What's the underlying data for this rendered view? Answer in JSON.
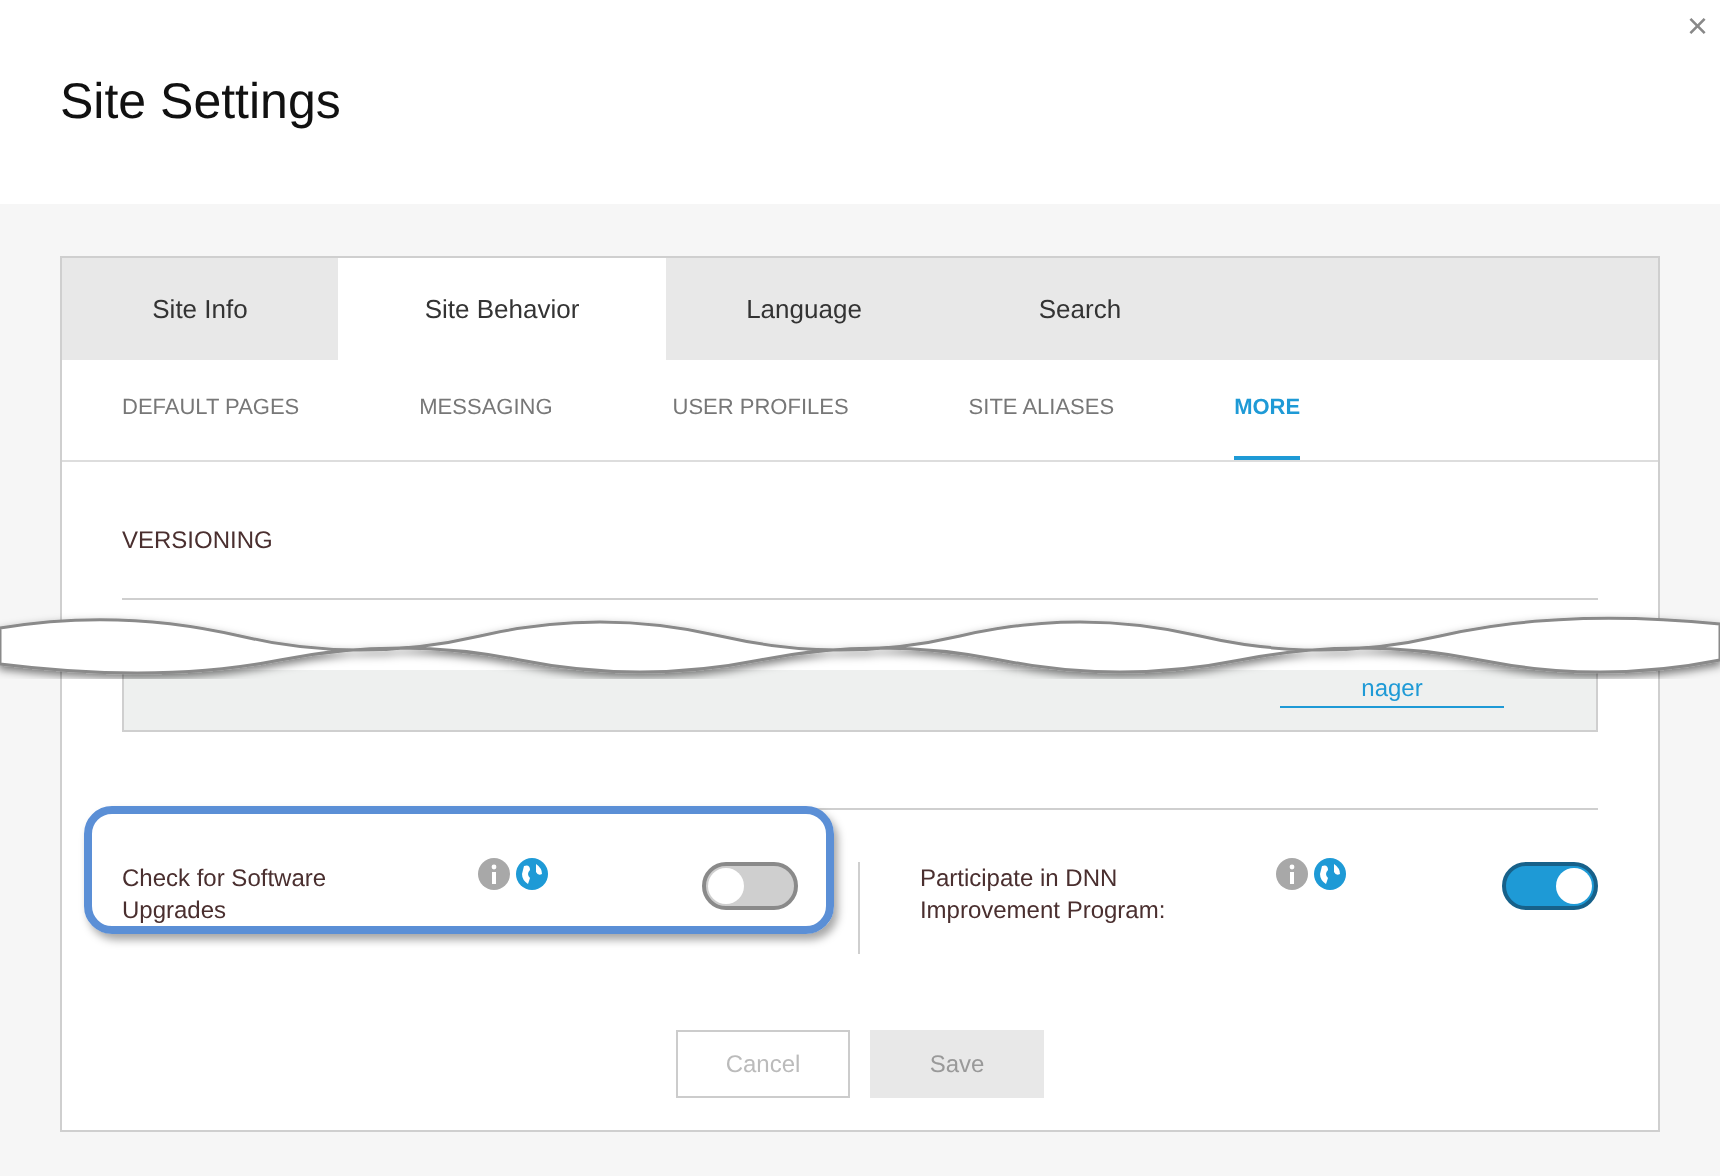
{
  "dialog": {
    "title": "Site Settings",
    "close": "×"
  },
  "tabs": [
    {
      "label": "Site Info",
      "selected": false
    },
    {
      "label": "Site Behavior",
      "selected": true
    },
    {
      "label": "Language",
      "selected": false
    },
    {
      "label": "Search",
      "selected": false
    }
  ],
  "subtabs": [
    {
      "label": "DEFAULT PAGES",
      "selected": false
    },
    {
      "label": "MESSAGING",
      "selected": false
    },
    {
      "label": "USER PROFILES",
      "selected": false
    },
    {
      "label": "SITE ALIASES",
      "selected": false
    },
    {
      "label": "MORE",
      "selected": true
    }
  ],
  "section": {
    "title": "VERSIONING",
    "link_fragment": "nager"
  },
  "settings": [
    {
      "label": "Check for Software Upgrades",
      "on": false,
      "highlighted": true
    },
    {
      "label": "Participate in DNN Improvement Program:",
      "on": true,
      "highlighted": false
    }
  ],
  "buttons": [
    {
      "label": "Cancel",
      "kind": "outline"
    },
    {
      "label": "Save",
      "kind": "filled"
    }
  ]
}
